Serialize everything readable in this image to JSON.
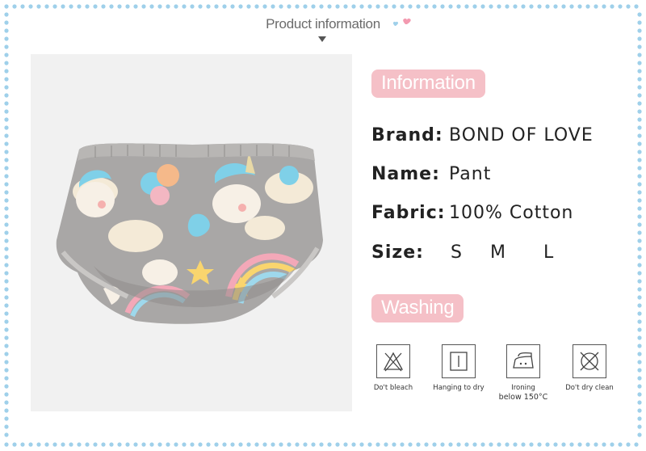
{
  "header": {
    "title": "Product information"
  },
  "info": {
    "section_label": "Information",
    "rows": [
      {
        "label": "Brand:",
        "value": "BOND OF LOVE"
      },
      {
        "label": "Name:",
        "value": "Pant"
      },
      {
        "label": "Fabric:",
        "value": "100% Cotton"
      },
      {
        "label": "Size:",
        "sizes": [
          "S",
          "M",
          "L"
        ]
      }
    ]
  },
  "washing": {
    "section_label": "Washing",
    "items": [
      {
        "icon": "no-bleach-icon",
        "caption": "Do't bleach"
      },
      {
        "icon": "hang-dry-icon",
        "caption": "Hanging to dry"
      },
      {
        "icon": "iron-icon",
        "caption_line1": "Ironing",
        "caption_line2": "below 150°C"
      },
      {
        "icon": "no-dry-clean-icon",
        "caption": "Do't dry clean"
      }
    ]
  },
  "colors": {
    "border_dots": "#9fd0ea",
    "pill": "#f5c0c7",
    "heart_pink": "#f39ab0",
    "heart_blue": "#9fd0ea"
  }
}
